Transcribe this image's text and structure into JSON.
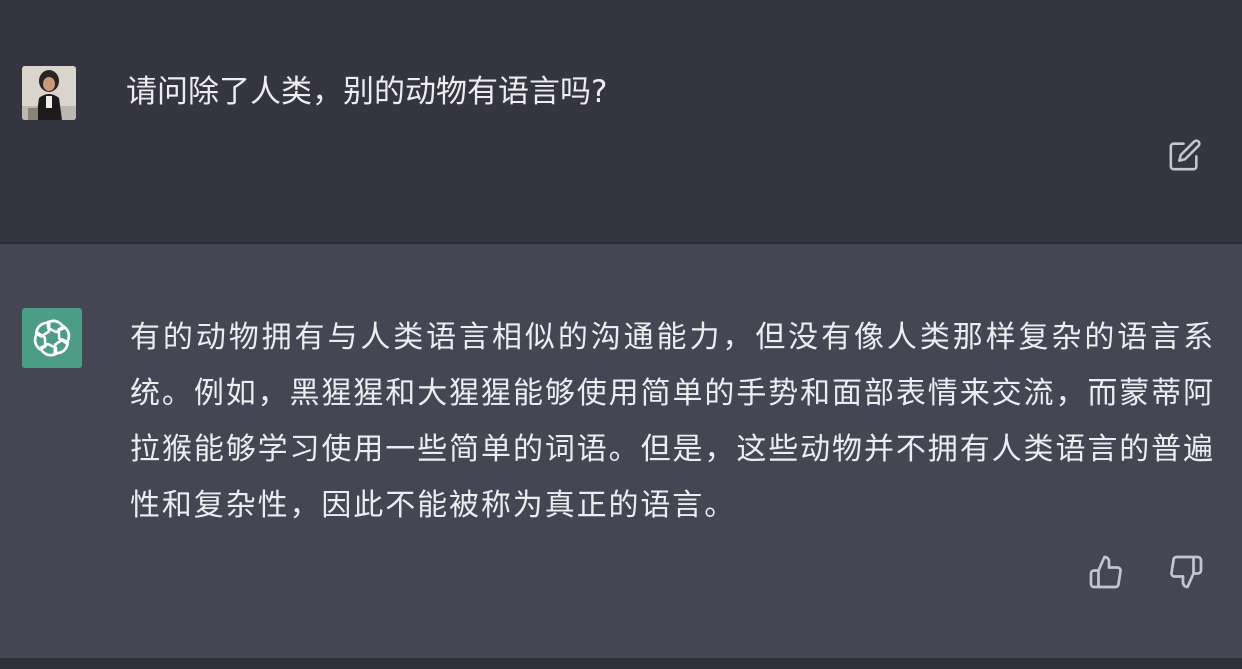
{
  "user_message": {
    "text": "请问除了人类，别的动物有语言吗?",
    "avatar_icon": "user-photo-avatar",
    "edit_icon": "edit-pencil-icon"
  },
  "assistant_message": {
    "text": "有的动物拥有与人类语言相似的沟通能力，但没有像人类那样复杂的语言系统。例如，黑猩猩和大猩猩能够使用简单的手势和面部表情来交流，而蒙蒂阿拉猴能够学习使用一些简单的词语。但是，这些动物并不拥有人类语言的普遍性和复杂性，因此不能被称为真正的语言。",
    "avatar_icon": "openai-logo-icon",
    "feedback": {
      "like_icon": "thumbs-up-icon",
      "dislike_icon": "thumbs-down-icon"
    }
  },
  "colors": {
    "user_bg": "#343541",
    "assistant_bg": "#444654",
    "gpt_avatar_bg": "#4c9d86",
    "text": "#ececf1",
    "icon": "#c5c5d2"
  }
}
